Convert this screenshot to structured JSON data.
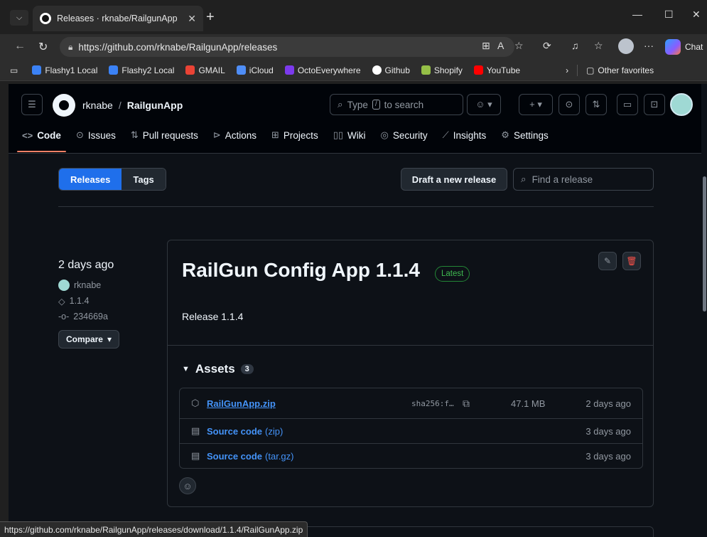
{
  "browser": {
    "tab_title": "Releases · rknabe/RailgunApp",
    "url": "https://github.com/rknabe/RailgunApp/releases",
    "chat_label": "Chat",
    "favorites": [
      {
        "label": "Flashy1 Local",
        "color": "#3b82f6"
      },
      {
        "label": "Flashy2 Local",
        "color": "#3b82f6"
      },
      {
        "label": "GMAIL",
        "color": "#ea4335"
      },
      {
        "label": "iCloud",
        "color": "#4f8ef7"
      },
      {
        "label": "OctoEverywhere",
        "color": "#7c3aed"
      },
      {
        "label": "Github",
        "color": "#ffffff"
      },
      {
        "label": "Shopify",
        "color": "#95bf47"
      },
      {
        "label": "YouTube",
        "color": "#ff0000"
      }
    ],
    "other_favorites": "Other favorites",
    "status_url": "https://github.com/rknabe/RailgunApp/releases/download/1.1.4/RailGunApp.zip"
  },
  "github": {
    "owner": "rknabe",
    "repo": "RailgunApp",
    "search_placeholder_a": "Type",
    "search_key": "/",
    "search_placeholder_b": "to search",
    "nav": [
      "Code",
      "Issues",
      "Pull requests",
      "Actions",
      "Projects",
      "Wiki",
      "Security",
      "Insights",
      "Settings"
    ]
  },
  "releases_page": {
    "seg_releases": "Releases",
    "seg_tags": "Tags",
    "draft_button": "Draft a new release",
    "find_placeholder": "Find a release"
  },
  "release": {
    "date": "2 days ago",
    "author": "rknabe",
    "tag": "1.1.4",
    "commit": "234669a",
    "compare": "Compare",
    "title": "RailGun Config App 1.1.4",
    "badge": "Latest",
    "description": "Release 1.1.4",
    "assets_label": "Assets",
    "assets_count": "3",
    "assets": [
      {
        "name": "RailGunApp.zip",
        "format": "",
        "sha": "sha256:f…",
        "size": "47.1 MB",
        "when": "2 days ago"
      },
      {
        "name": "Source code",
        "format": "(zip)",
        "sha": "",
        "size": "",
        "when": "3 days ago"
      },
      {
        "name": "Source code",
        "format": "(tar.gz)",
        "sha": "",
        "size": "",
        "when": "3 days ago"
      }
    ]
  },
  "colors": {
    "accent_blue": "#1f6feb",
    "link_blue": "#4493f8",
    "latest_green": "#3fb950",
    "active_tab_underline": "#f78166"
  }
}
